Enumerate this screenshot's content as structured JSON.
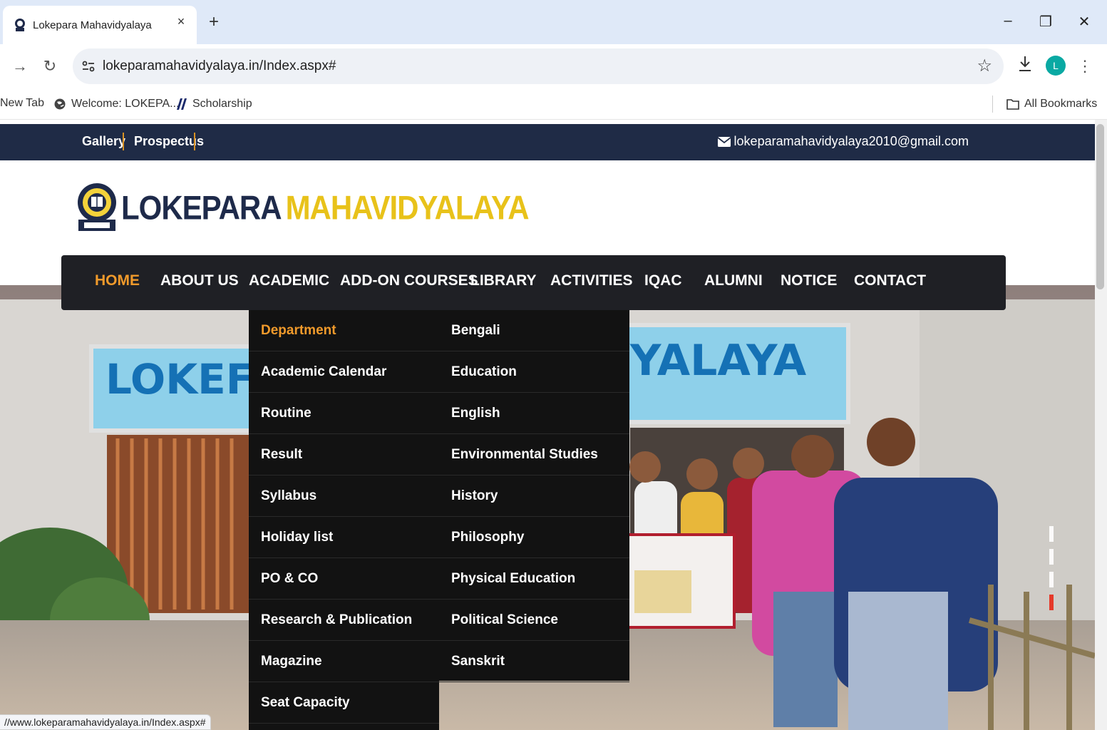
{
  "browser": {
    "tab": {
      "title": "Lokepara Mahavidyalaya",
      "close": "×"
    },
    "new_tab": "+",
    "window_controls": {
      "minimize": "–",
      "restore": "❐",
      "close": "✕"
    },
    "nav": {
      "back": "→",
      "reload": "↻"
    },
    "url": "lokeparamahavidyalaya.in/Index.aspx#",
    "bookmark_star": "☆",
    "download_icon": "download-icon",
    "avatar_letter": "L",
    "menu": "⋮",
    "bookmarks": [
      {
        "label": "New Tab",
        "icon": "none"
      },
      {
        "label": "Welcome: LOKEPA...",
        "icon": "globe-icon"
      },
      {
        "label": "Scholarship",
        "icon": "scholarship-icon"
      }
    ],
    "all_bookmarks": "All Bookmarks",
    "status_url": "//www.lokeparamahavidyalaya.in/Index.aspx#"
  },
  "site": {
    "top_links": [
      "Gallery",
      "Prospectus"
    ],
    "email": "lokeparamahavidyalaya2010@gmail.com",
    "logo": {
      "word1": "LOKEPARA",
      "word2": "MAHAVIDYALAYA"
    },
    "nav": [
      "HOME",
      "ABOUT US",
      "ACADEMIC",
      "ADD-ON COURSES",
      "LIBRARY",
      "ACTIVITIES",
      "IQAC",
      "ALUMNI",
      "NOTICE",
      "CONTACT"
    ],
    "nav_active": "HOME",
    "academic_menu": [
      "Department",
      "Academic Calendar",
      "Routine",
      "Result",
      "Syllabus",
      "Holiday list",
      "PO & CO",
      "Research & Publication",
      "Magazine",
      "Seat Capacity"
    ],
    "department_menu": [
      "Bengali",
      "Education",
      "English",
      "Environmental Studies",
      "History",
      "Philosophy",
      "Physical Education",
      "Political Science",
      "Sanskrit"
    ],
    "hero_sign_left": "LOKEF",
    "hero_sign_right": "YALAYA"
  },
  "colors": {
    "topbar": "#1f2b46",
    "accent": "#f09a2b",
    "nav_bg": "#1f2025",
    "dropdown_bg": "#121212",
    "logo_gold": "#e8c21a"
  }
}
